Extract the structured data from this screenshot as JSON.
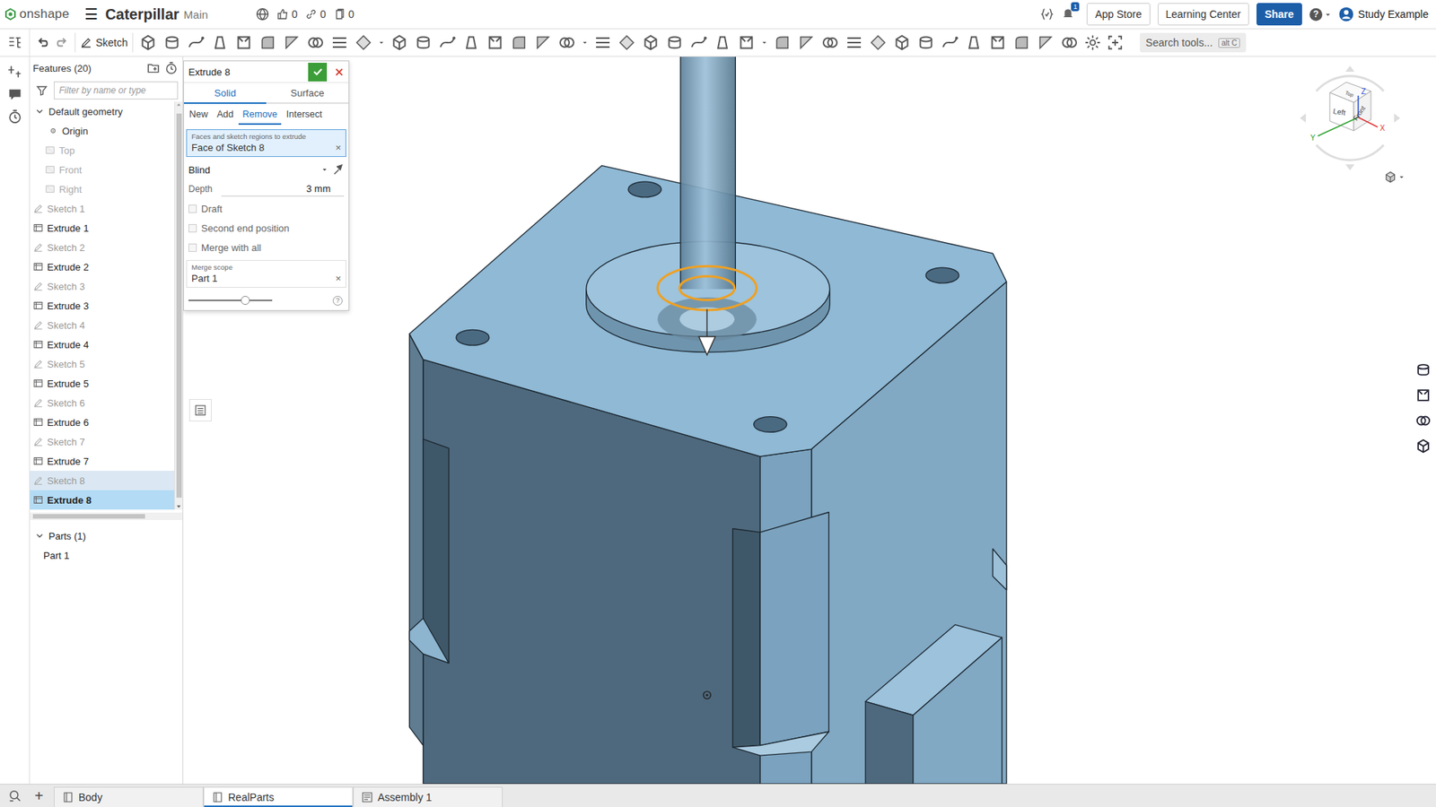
{
  "topbar": {
    "logo": "onshape",
    "menu": "☰",
    "document": "Caterpillar",
    "branch": "Main",
    "likes": "0",
    "links": "0",
    "copies": "0",
    "notification_count": "1",
    "buttons": [
      "App Store",
      "Learning Center"
    ],
    "share": "Share",
    "help": "?",
    "user": "Study Example"
  },
  "toolbar": {
    "sketch": "Sketch",
    "search": "Search tools...",
    "shortcut": "alt C"
  },
  "features": {
    "title": "Features (20)",
    "filter_placeholder": "Filter by name or type",
    "items": [
      {
        "label": "Default geometry",
        "kind": "group",
        "expanded": true,
        "selected": false,
        "highlighted": false
      },
      {
        "label": "Origin",
        "kind": "origin",
        "selected": false,
        "highlighted": false
      },
      {
        "label": "Top",
        "kind": "plane",
        "selected": false,
        "highlighted": false
      },
      {
        "label": "Front",
        "kind": "plane",
        "selected": false,
        "highlighted": false
      },
      {
        "label": "Right",
        "kind": "plane",
        "selected": false,
        "highlighted": false
      },
      {
        "label": "Sketch 1",
        "kind": "sketch",
        "selected": false,
        "highlighted": false
      },
      {
        "label": "Extrude 1",
        "kind": "extrude",
        "selected": false,
        "highlighted": false
      },
      {
        "label": "Sketch 2",
        "kind": "sketch",
        "selected": false,
        "highlighted": false
      },
      {
        "label": "Extrude 2",
        "kind": "extrude",
        "selected": false,
        "highlighted": false
      },
      {
        "label": "Sketch 3",
        "kind": "sketch",
        "selected": false,
        "highlighted": false
      },
      {
        "label": "Extrude 3",
        "kind": "extrude",
        "selected": false,
        "highlighted": false
      },
      {
        "label": "Sketch 4",
        "kind": "sketch",
        "selected": false,
        "highlighted": false
      },
      {
        "label": "Extrude 4",
        "kind": "extrude",
        "selected": false,
        "highlighted": false
      },
      {
        "label": "Sketch 5",
        "kind": "sketch",
        "selected": false,
        "highlighted": false
      },
      {
        "label": "Extrude 5",
        "kind": "extrude",
        "selected": false,
        "highlighted": false
      },
      {
        "label": "Sketch 6",
        "kind": "sketch",
        "selected": false,
        "highlighted": false
      },
      {
        "label": "Extrude 6",
        "kind": "extrude",
        "selected": false,
        "highlighted": false
      },
      {
        "label": "Sketch 7",
        "kind": "sketch",
        "selected": false,
        "highlighted": false
      },
      {
        "label": "Extrude 7",
        "kind": "extrude",
        "selected": false,
        "highlighted": false
      },
      {
        "label": "Sketch 8",
        "kind": "sketch",
        "selected": false,
        "highlighted": true
      },
      {
        "label": "Extrude 8",
        "kind": "extrude",
        "selected": true,
        "highlighted": false
      }
    ]
  },
  "parts": {
    "label": "Parts (1)",
    "expanded": true,
    "items": [
      {
        "label": "Part 1",
        "selected": false
      }
    ]
  },
  "dialog": {
    "title": "Extrude 8",
    "body_tabs": [
      {
        "label": "Solid",
        "selected": true
      },
      {
        "label": "Surface",
        "selected": false
      }
    ],
    "operations": [
      {
        "label": "New",
        "selected": false
      },
      {
        "label": "Add",
        "selected": false
      },
      {
        "label": "Remove",
        "selected": true
      },
      {
        "label": "Intersect",
        "selected": false
      }
    ],
    "selection_label": "Faces and sketch regions to extrude",
    "selection_value": "Face of Sketch 8",
    "clear": "×",
    "end_type": "Blind",
    "depth_label": "Depth",
    "depth": "3 mm",
    "options": [
      {
        "label": "Draft",
        "checked": false
      },
      {
        "label": "Second end position",
        "checked": false
      },
      {
        "label": "Merge with all",
        "checked": false
      }
    ],
    "merge_scope_label": "Merge scope",
    "merge_scope": "Part 1",
    "slider": {
      "level": 0.68
    },
    "help": "?"
  },
  "viewcube": {
    "faces": [
      "Left",
      "Front",
      "Top"
    ],
    "axes": [
      {
        "label": "X",
        "color": "#e03030"
      },
      {
        "label": "Y",
        "color": "#2aa02a"
      },
      {
        "label": "Z",
        "color": "#2850d0"
      }
    ]
  },
  "doc_tabs": {
    "add": "+",
    "tabs": [
      {
        "label": "Body",
        "kind": "partstudio",
        "selected": false
      },
      {
        "label": "RealParts",
        "kind": "partstudio",
        "selected": true
      },
      {
        "label": "Assembly 1",
        "kind": "assembly",
        "selected": false
      }
    ]
  }
}
